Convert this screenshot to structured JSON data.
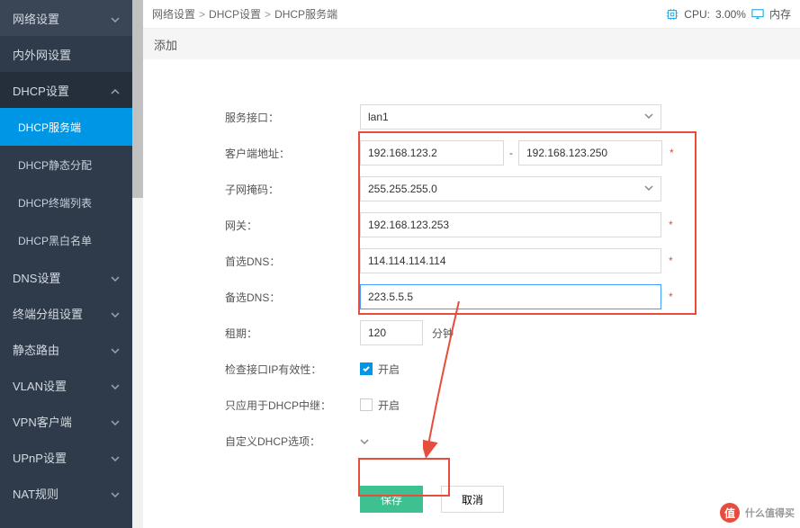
{
  "sidebar": {
    "items": [
      {
        "label": "网络设置",
        "open": false
      },
      {
        "label": "内外网设置",
        "open": null
      },
      {
        "label": "DHCP设置",
        "open": true,
        "subs": [
          {
            "label": "DHCP服务端",
            "active": true
          },
          {
            "label": "DHCP静态分配"
          },
          {
            "label": "DHCP终端列表"
          },
          {
            "label": "DHCP黑白名单"
          }
        ]
      },
      {
        "label": "DNS设置",
        "open": false
      },
      {
        "label": "终端分组设置",
        "open": false
      },
      {
        "label": "静态路由",
        "open": false
      },
      {
        "label": "VLAN设置",
        "open": false
      },
      {
        "label": "VPN客户端",
        "open": false
      },
      {
        "label": "UPnP设置",
        "open": false
      },
      {
        "label": "NAT规则",
        "open": false
      }
    ]
  },
  "breadcrumb": [
    "网络设置",
    "DHCP设置",
    "DHCP服务端"
  ],
  "cpu": {
    "label": "CPU:",
    "value": "3.00%"
  },
  "mem_label": "内存",
  "subhead": "添加",
  "form": {
    "iface": {
      "label": "服务接口：",
      "value": "lan1"
    },
    "client": {
      "label": "客户端地址：",
      "start": "192.168.123.2",
      "end": "192.168.123.250"
    },
    "mask": {
      "label": "子网掩码：",
      "value": "255.255.255.0"
    },
    "gw": {
      "label": "网关：",
      "value": "192.168.123.253"
    },
    "dns1": {
      "label": "首选DNS：",
      "value": "114.114.114.114"
    },
    "dns2": {
      "label": "备选DNS：",
      "value": "223.5.5.5"
    },
    "lease": {
      "label": "租期：",
      "value": "120",
      "unit": "分钟"
    },
    "check": {
      "label": "检查接口IP有效性：",
      "text": "开启"
    },
    "relay": {
      "label": "只应用于DHCP中继：",
      "text": "开启"
    },
    "custom": {
      "label": "自定义DHCP选项："
    },
    "save": "保存",
    "cancel": "取消"
  },
  "watermark": {
    "char": "值",
    "text": "什么值得买"
  }
}
